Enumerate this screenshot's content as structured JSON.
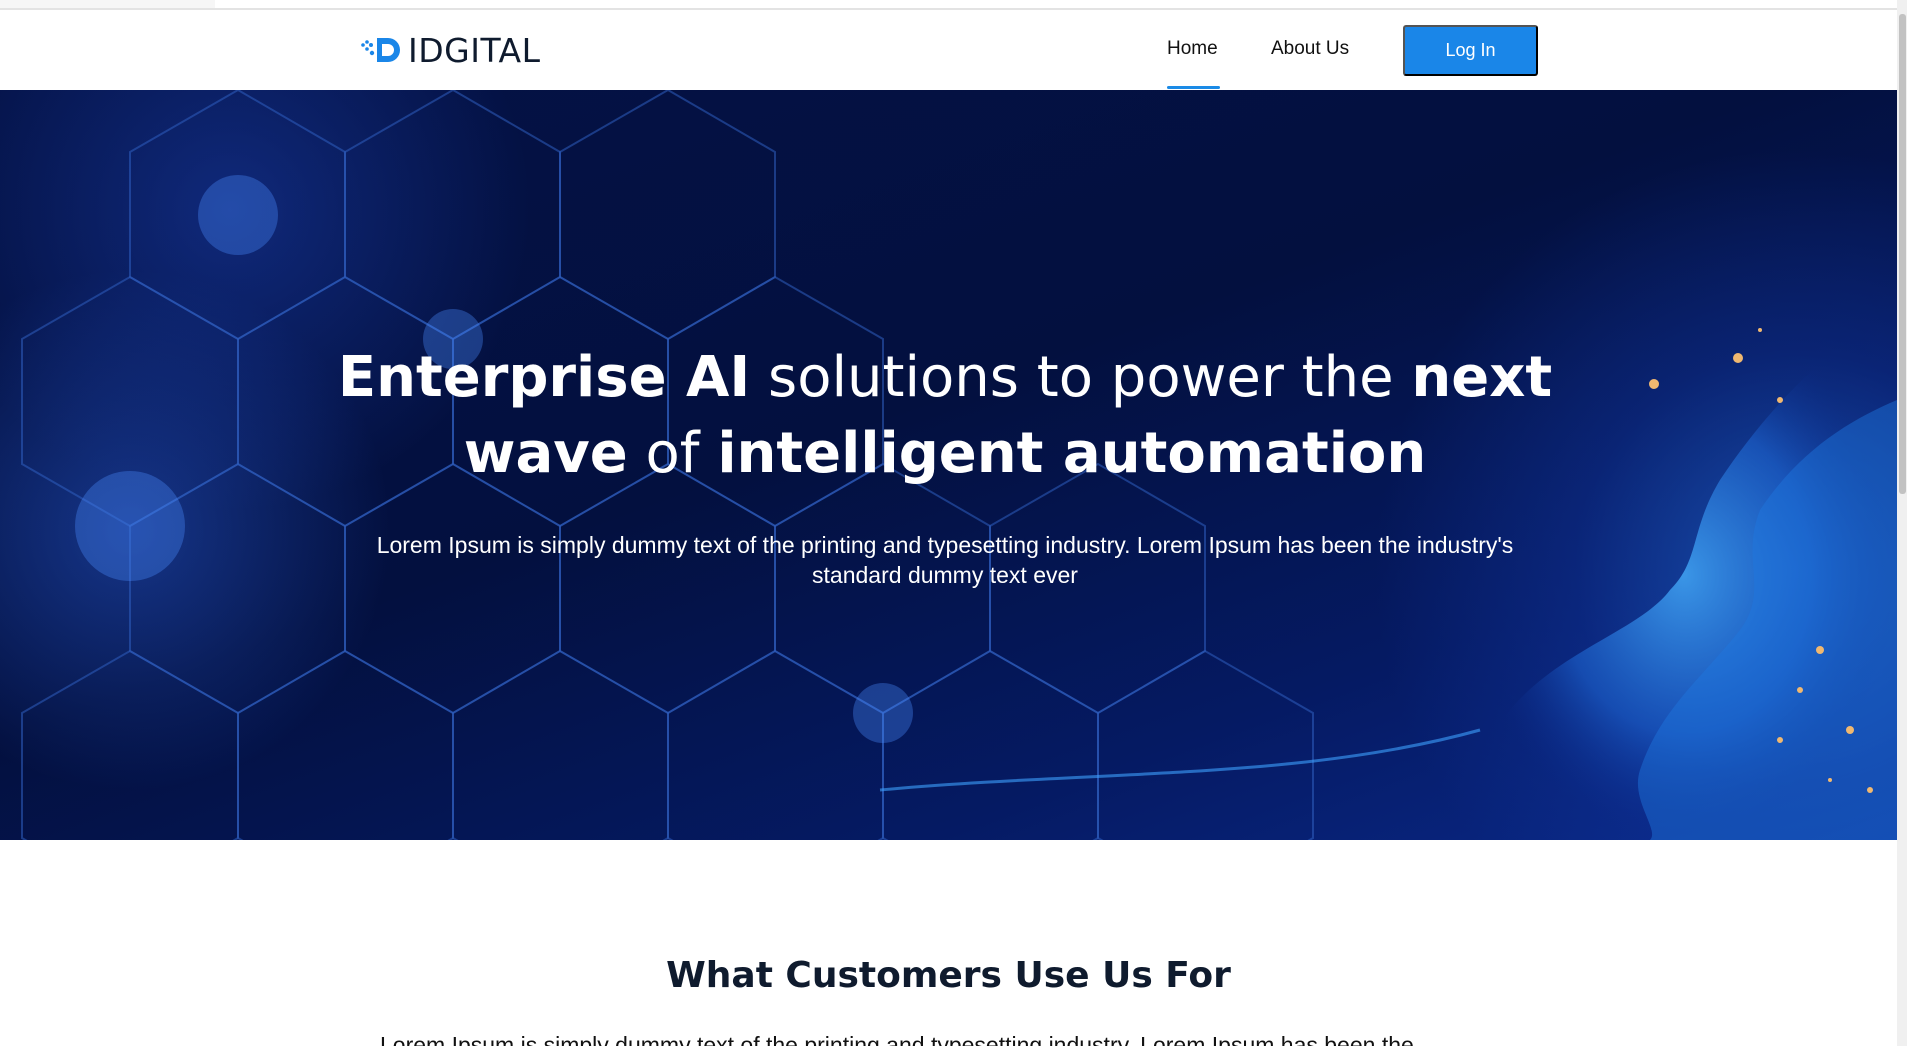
{
  "brand": {
    "name": "IDGITAL",
    "accent": "#1a86e8",
    "dark": "#0f1b2e"
  },
  "nav": {
    "home_label": "Home",
    "about_label": "About Us",
    "login_label": "Log In",
    "active": "Home"
  },
  "hero": {
    "title_part1": "Enterprise AI",
    "title_part2": " solutions to power the ",
    "title_part3": "next",
    "title_part4": "wave",
    "title_part5": " of ",
    "title_part6": "intelligent automation",
    "subtitle": "Lorem Ipsum is simply dummy text of the printing and typesetting industry. Lorem Ipsum has been the industry's standard dummy text ever"
  },
  "section": {
    "title": "What Customers Use Us For",
    "text": "Lorem Ipsum is simply dummy text of the printing and typesetting industry. Lorem Ipsum has been the"
  }
}
